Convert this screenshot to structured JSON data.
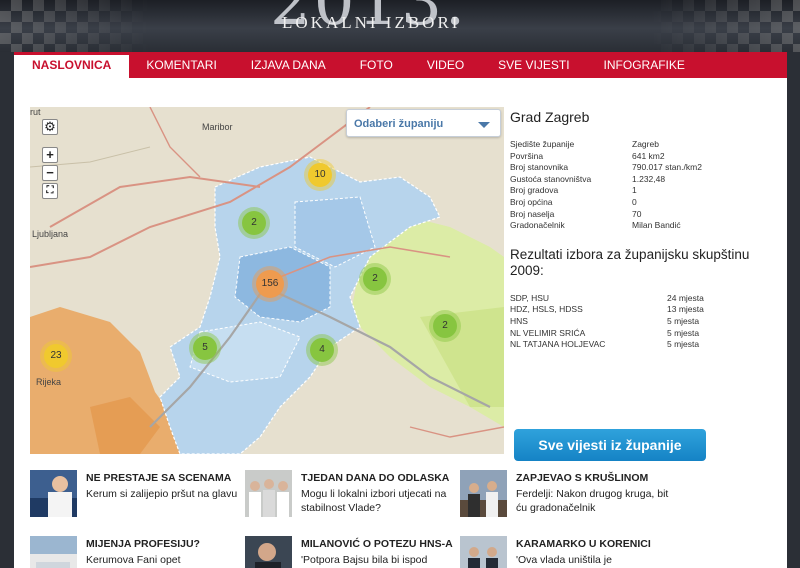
{
  "banner": {
    "year": "2013.",
    "subtitle": "LOKALNI IZBORI"
  },
  "nav": {
    "items": [
      {
        "label": "NASLOVNICA",
        "active": true
      },
      {
        "label": "KOMENTARI"
      },
      {
        "label": "IZJAVA DANA"
      },
      {
        "label": "FOTO"
      },
      {
        "label": "VIDEO"
      },
      {
        "label": "SVE VIJESTI"
      },
      {
        "label": "INFOGRAFIKE"
      }
    ]
  },
  "map": {
    "select_label": "Odaberi županiju",
    "controls": {
      "zoom_in": "+",
      "zoom_out": "−"
    },
    "place_labels": {
      "maribor": "Maribor",
      "ljubljana": "Ljubljana",
      "rijeka": "Rijeka",
      "trst": "rut"
    },
    "clusters": [
      {
        "count": "10",
        "color": "yellow"
      },
      {
        "count": "2",
        "color": "green"
      },
      {
        "count": "156",
        "color": "orange"
      },
      {
        "count": "2",
        "color": "green"
      },
      {
        "count": "2",
        "color": "green"
      },
      {
        "count": "5",
        "color": "green"
      },
      {
        "count": "4",
        "color": "green"
      },
      {
        "count": "23",
        "color": "yellow"
      }
    ]
  },
  "info": {
    "title": "Grad Zagreb",
    "rows": [
      {
        "k": "Sjedište županije",
        "v": "Zagreb"
      },
      {
        "k": "Površina",
        "v": "641 km2"
      },
      {
        "k": "Broj stanovnika",
        "v": "790.017 stan./km2"
      },
      {
        "k": "Gustoća stanovništva",
        "v": "1.232,48"
      },
      {
        "k": "Broj gradova",
        "v": "1"
      },
      {
        "k": "Broj općina",
        "v": "0"
      },
      {
        "k": "Broj naselja",
        "v": "70"
      },
      {
        "k": "Gradonačelnik",
        "v": "Milan Bandić"
      }
    ],
    "results_title": "Rezultati izbora za županijsku skupštinu 2009:",
    "results": [
      {
        "k": "SDP, HSU",
        "v": "24 mjesta"
      },
      {
        "k": "HDZ, HSLS, HDSS",
        "v": "13 mjesta"
      },
      {
        "k": "HNS",
        "v": "5 mjesta"
      },
      {
        "k": "NL VELIMIR SRIĆA",
        "v": "5 mjesta"
      },
      {
        "k": "NL TATJANA HOLJEVAC",
        "v": "5 mjesta"
      }
    ],
    "button_label": "Sve vijesti iz županije"
  },
  "news": [
    {
      "kicker": "NE PRESTAJE SA SCENAMA",
      "headline": "Kerum si zalijepio pršut na glavu"
    },
    {
      "kicker": "TJEDAN DANA DO ODLASKA",
      "headline": "Mogu li lokalni izbori utjecati na stabilnost Vlade?"
    },
    {
      "kicker": "ZAPJEVAO S KRUŠLINOM",
      "headline": "Ferdelji: Nakon drugog kruga, bit ću gradonačelnik"
    },
    {
      "kicker": "MIJENJA PROFESIJU?",
      "headline": "Kerumova Fani opet"
    },
    {
      "kicker": "MILANOVIĆ O POTEZU HNS-A",
      "headline": "'Potpora Bajsu bila bi ispod"
    },
    {
      "kicker": "KARAMARKO U KORENICI",
      "headline": "'Ova vlada uništila je"
    }
  ],
  "colors": {
    "nav_red": "#c8102e",
    "button_blue": "#1a8fd0",
    "region_blue": "#9cc3e3",
    "region_green": "#d9ec9a"
  }
}
